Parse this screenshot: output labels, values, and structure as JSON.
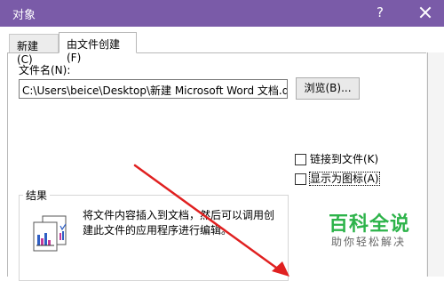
{
  "window": {
    "title": "对象",
    "help_label": "?"
  },
  "tabs": [
    {
      "label": "新建(C)",
      "active": false
    },
    {
      "label": "由文件创建(F)",
      "active": true
    }
  ],
  "file_name": {
    "label": "文件名(N):",
    "value": "C:\\Users\\beice\\Desktop\\新建 Microsoft Word 文档.docx"
  },
  "browse_button": {
    "label": "浏览(B)..."
  },
  "options": {
    "link_to_file": {
      "label": "链接到文件(K)",
      "checked": false
    },
    "display_as_icon": {
      "label": "显示为图标(A)",
      "checked": false
    }
  },
  "result": {
    "title": "结果",
    "description": "将文件内容插入到文档，然后可以调用创建此文件的应用程序进行编辑。"
  },
  "watermark": {
    "brand": "百科全说",
    "slogan": "助你轻松解决"
  },
  "colors": {
    "titlebar": "#7a5ba8",
    "watermark_green": "#2db34a",
    "arrow_red": "#e02020"
  }
}
